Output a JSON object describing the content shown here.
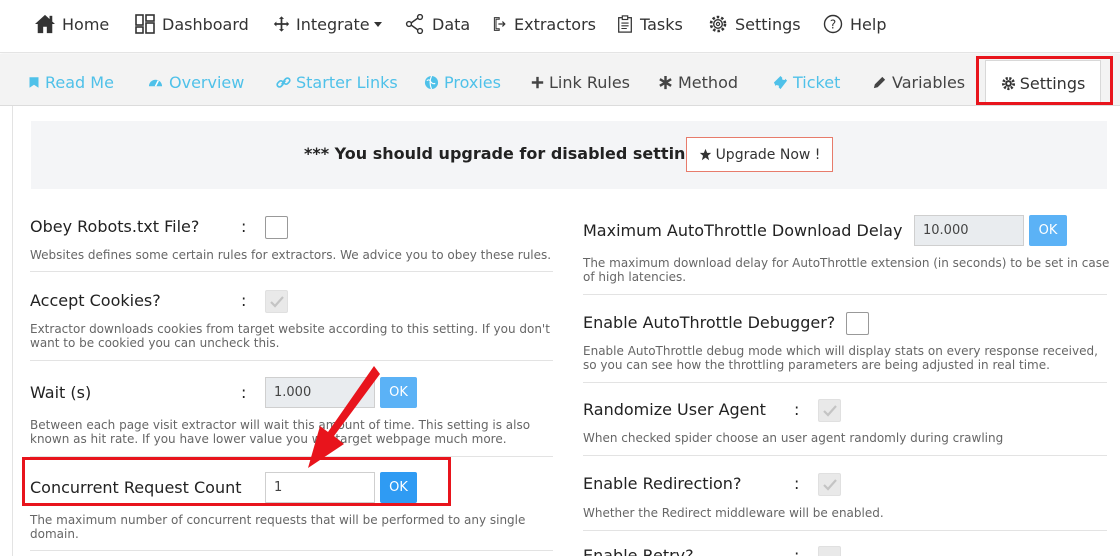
{
  "nav": {
    "home": "Home",
    "dashboard": "Dashboard",
    "integrate": "Integrate",
    "data": "Data",
    "extractors": "Extractors",
    "tasks": "Tasks",
    "settings": "Settings",
    "help": "Help"
  },
  "tabs": {
    "read_me": "Read Me",
    "overview": "Overview",
    "starter_links": "Starter Links",
    "proxies": "Proxies",
    "link_rules": "Link Rules",
    "method": "Method",
    "ticket": "Ticket",
    "variables": "Variables",
    "settings": "Settings"
  },
  "banner": {
    "text": "*** You should upgrade for disabled settings.",
    "button": "Upgrade Now !"
  },
  "left": {
    "robots": {
      "label": "Obey Robots.txt File?",
      "colon": ":",
      "desc": "Websites defines some certain rules for extractors. We advice you to obey these rules."
    },
    "cookies": {
      "label": "Accept Cookies?",
      "colon": ":",
      "desc": "Extractor downloads cookies from target website according to this setting. If you don't want to be cookied you can uncheck this."
    },
    "wait": {
      "label": "Wait (s)",
      "colon": ":",
      "value": "1.000",
      "ok": "OK",
      "desc": "Between each page visit extractor will wait this amount of time. This setting is also known as hit rate. If you have lower value you will target webpage much more."
    },
    "concurrent": {
      "label": "Concurrent Request Count",
      "value": "1",
      "ok": "OK",
      "desc": "The maximum number of concurrent requests that will be performed to any single domain."
    }
  },
  "right": {
    "max_delay": {
      "label": "Maximum AutoThrottle Download Delay",
      "value": "10.000",
      "ok": "OK",
      "desc": "The maximum download delay for AutoThrottle extension (in seconds) to be set in case of high latencies."
    },
    "debugger": {
      "label": "Enable AutoThrottle Debugger?",
      "desc": "Enable AutoThrottle debug mode which will display stats on every response received, so you can see how the throttling parameters are being adjusted in real time."
    },
    "user_agent": {
      "label": "Randomize User Agent",
      "colon": ":",
      "desc": "When checked spider choose an user agent randomly during crawling"
    },
    "redirection": {
      "label": "Enable Redirection?",
      "colon": ":",
      "desc": "Whether the Redirect middleware will be enabled."
    },
    "retry": {
      "label": "Enable Retry?",
      "colon": ":"
    }
  },
  "colors": {
    "accent": "#4fc1e9",
    "ok_button": "#2f9bf3",
    "highlight": "#e8141c"
  }
}
